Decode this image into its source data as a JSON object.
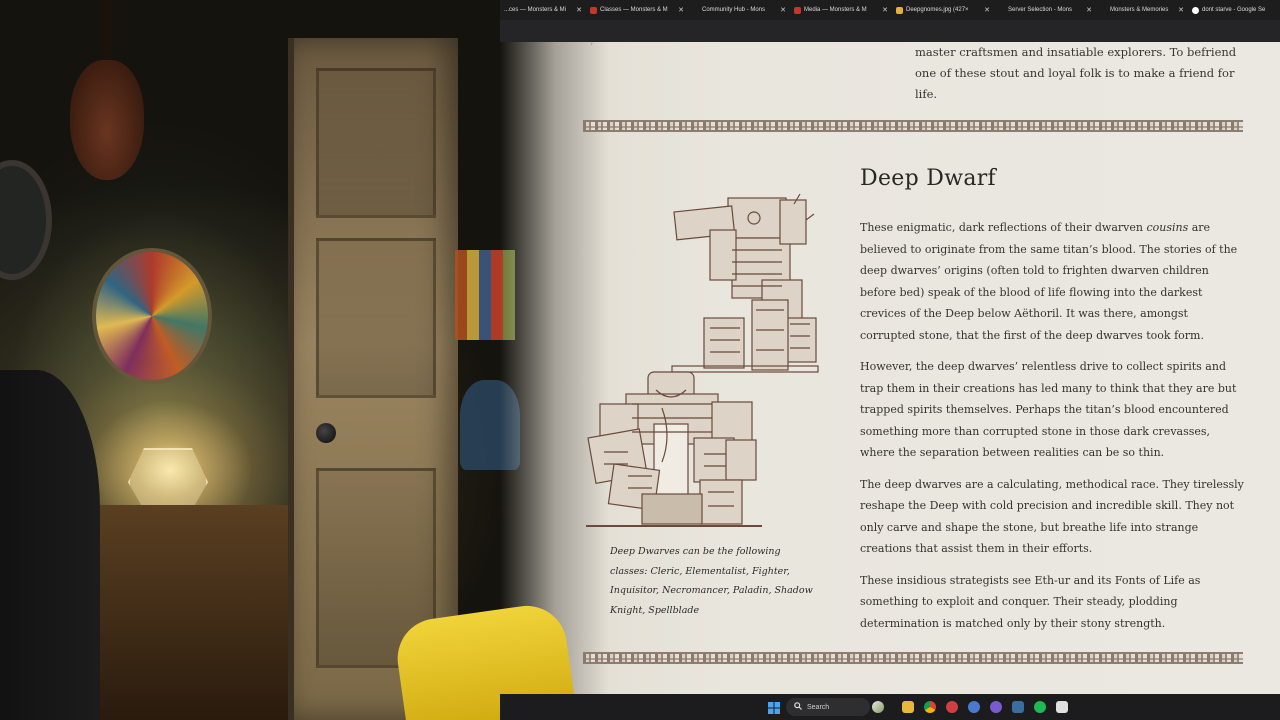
{
  "browser": {
    "tabs": [
      {
        "label": "...ces — Monsters & Mi",
        "color": "#5a3a2a"
      },
      {
        "label": "Classes — Monsters & M",
        "color": "#c0392b"
      },
      {
        "label": "Community Hub - Mons",
        "color": "#444444"
      },
      {
        "label": "Media — Monsters & M",
        "color": "#c0392b"
      },
      {
        "label": "Deepgnomes.jpg (427×",
        "color": "#e0b040"
      },
      {
        "label": "Server Selection - Mons",
        "color": "#444444"
      },
      {
        "label": "Monsters & Memories",
        "color": "#444444"
      },
      {
        "label": "dont starve - Google Se",
        "color": "#ffffff"
      }
    ]
  },
  "page": {
    "prev_section_text": "master craftsmen and insatiable explorers. To befriend one of these stout and loyal folk is to make a friend for life.",
    "heading": "Deep Dwarf",
    "paragraphs": [
      {
        "before": "These enigmatic, dark reflections of their dwarven ",
        "em": "cousins",
        "after": " are believed to originate from the same titan’s blood. The stories of the deep dwarves’ origins (often told to frighten dwarven children before bed) speak of the blood of life flowing into the darkest crevices of the Deep below Aëthoril. It was there, amongst corrupted stone, that the first of the deep dwarves took form."
      },
      {
        "text": "However, the deep dwarves’ relentless drive to collect spirits and trap them in their creations has led many to think that they are but trapped spirits themselves. Perhaps the titan’s blood encountered something more than corrupted stone in those dark crevasses, where the separation between realities can be so thin."
      },
      {
        "text": "The deep dwarves are a calculating, methodical race. They tirelessly reshape the Deep with cold precision and incredible skill. They not only carve and shape the stone, but breathe life into strange creations that assist them in their efforts."
      },
      {
        "text": "These insidious strategists see Eth-ur and its Fonts of Life as something to exploit and conquer. Their steady, plodding determination is matched only by their stony strength."
      }
    ],
    "caption": "Deep Dwarves can be the following classes: Cleric, Elementalist, Fighter, Inquisitor, Necromancer, Paladin, Shadow Knight, Spellblade"
  },
  "taskbar": {
    "search_label": "Search"
  },
  "icons": {
    "windows": "windows-logo-icon",
    "search": "search-icon"
  }
}
